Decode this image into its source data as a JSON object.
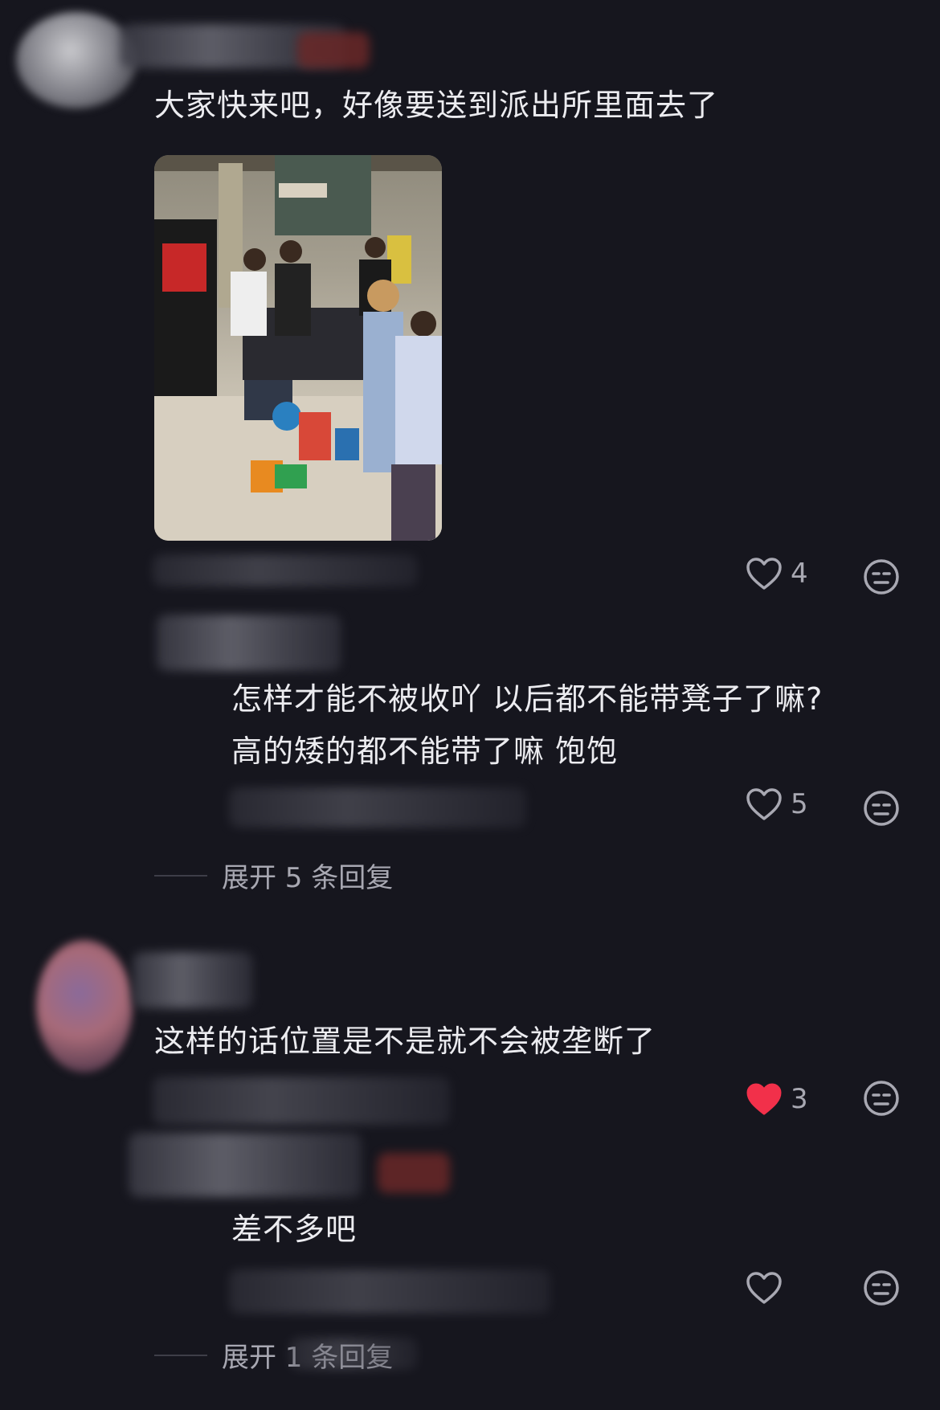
{
  "colors": {
    "background": "#16161e",
    "text": "#ececf0",
    "meta": "#5a5a66",
    "liked_heart": "#f2304a"
  },
  "comments": [
    {
      "text": "大家快来吧，好像要送到派出所里面去了",
      "likes": "4",
      "liked": false,
      "has_photo": true
    },
    {
      "text_line1": "怎样才能不被收吖 以后都不能带凳子了嘛?",
      "text_line2": "高的矮的都不能带了嘛 饱饱",
      "likes": "5",
      "liked": false,
      "expand": "展开 5 条回复"
    },
    {
      "text": "这样的话位置是不是就不会被垄断了",
      "likes": "3",
      "liked": true
    },
    {
      "text": "差不多吧",
      "likes": "",
      "liked": false,
      "expand": "展开 1 条回复"
    }
  ],
  "icons": {
    "like": "heart-outline-icon",
    "liked": "heart-filled-icon",
    "dislike": "meh-face-icon"
  }
}
